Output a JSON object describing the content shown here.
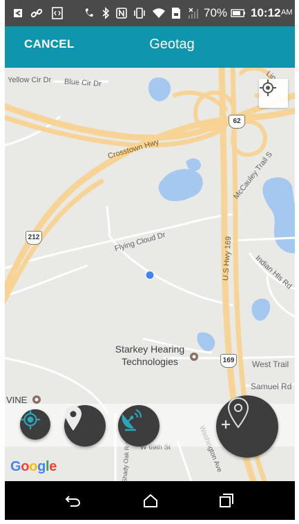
{
  "status_bar": {
    "battery_percent": "70%",
    "time": "10:12",
    "ampm": "AM"
  },
  "app_bar": {
    "cancel_label": "CANCEL",
    "title": "Geotag"
  },
  "map": {
    "roads": {
      "yellow_cir": "Yellow Cir Dr",
      "blue_cir": "Blue Cir Dr",
      "crosstown": "Crosstown Hwy",
      "mccauley": "McCauley Trail S",
      "flying_cloud": "Flying Cloud Dr",
      "us_hwy": "U.S Hwy 169",
      "indian_hills": "Indian Hls Rd",
      "west_trail": "West Trail",
      "samuel": "Samuel Rd",
      "w_69th": "W 69th St",
      "shady_oak": "Shady Oak Rd",
      "washington": "Washington Ave",
      "lincoln": "Lin"
    },
    "shields": {
      "hwy_62": "62",
      "hwy_212": "212",
      "hwy_169": "169"
    },
    "pois": {
      "starkey_line1": "Starkey Hearing",
      "starkey_line2": "Technologies",
      "vine": "VINE"
    },
    "google_logo": [
      "G",
      "o",
      "o",
      "g",
      "l",
      "e"
    ]
  },
  "colors": {
    "app_bar": "#0f95ad",
    "status_bar": "#4a4a4a",
    "map_bg": "#e9e9e6",
    "highway": "#f7d495",
    "water": "#a5c8f0",
    "fab": "#3d3d3d",
    "accent_icon": "#2aa7bd",
    "location_dot": "#4285f4"
  },
  "icons": {
    "gps": "crosshair-icon",
    "pin": "map-pin-icon",
    "satellite": "satellite-dish-icon",
    "add_pin": "add-location-icon"
  }
}
